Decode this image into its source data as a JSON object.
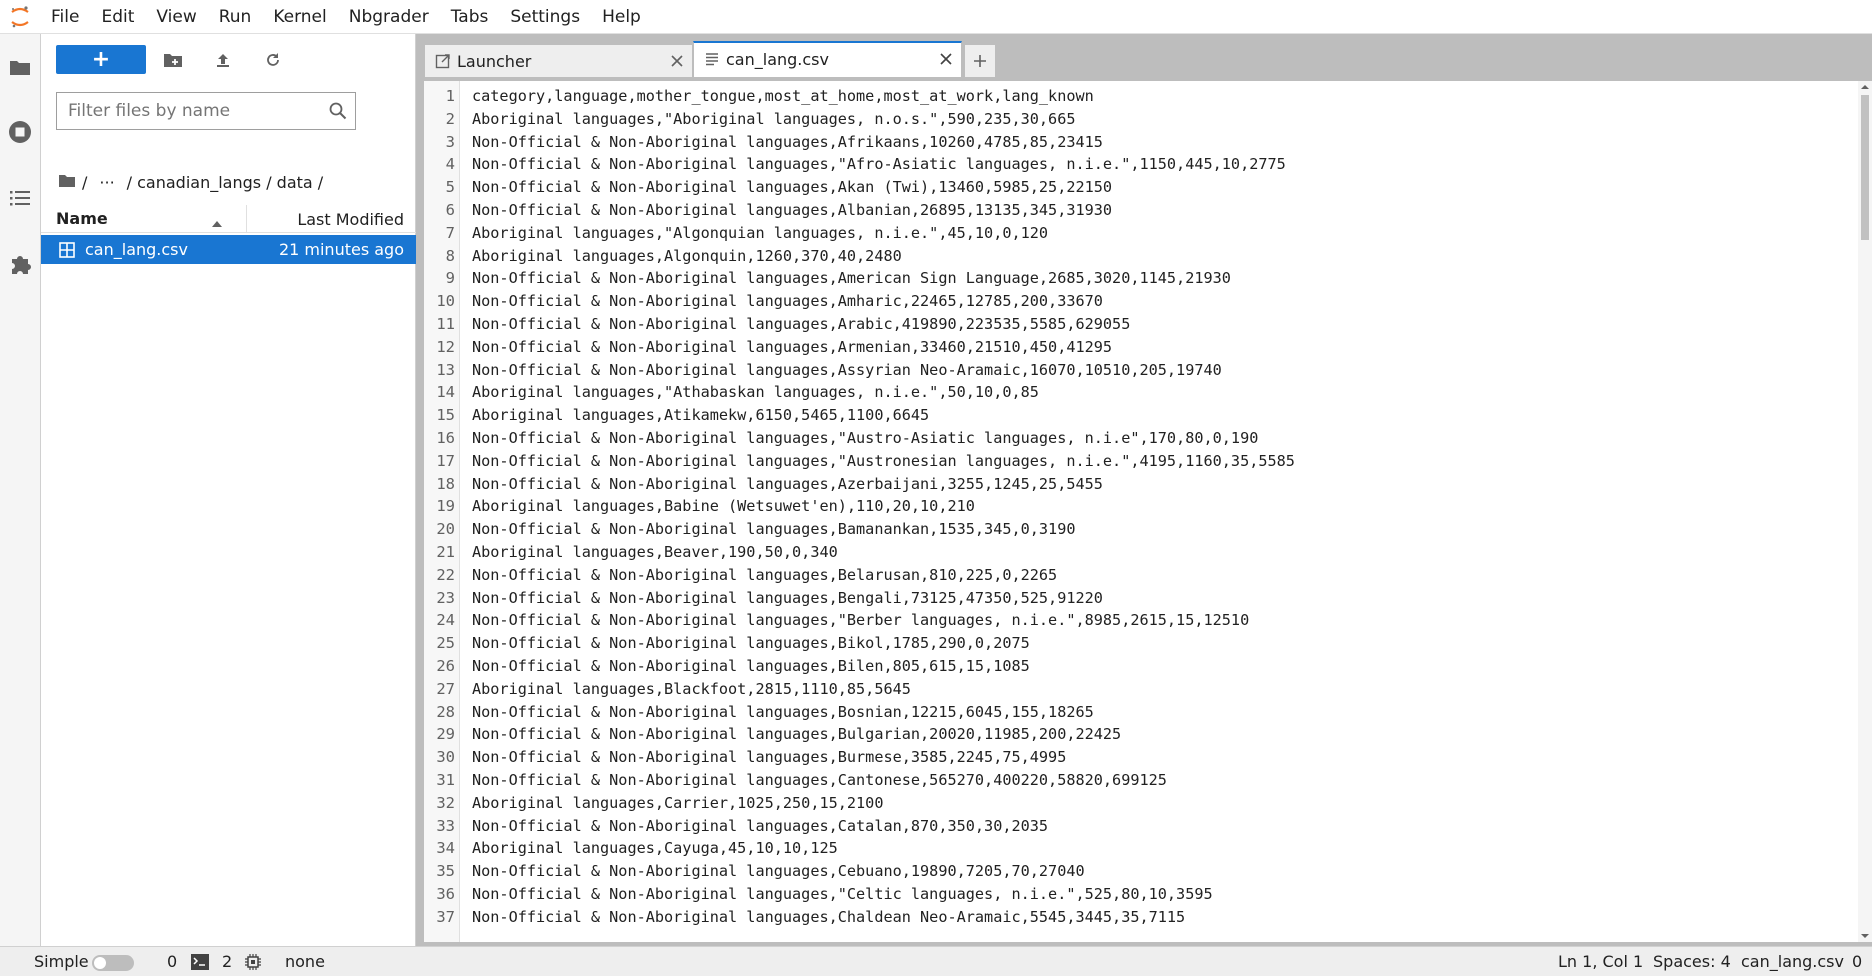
{
  "menubar": {
    "items": [
      "File",
      "Edit",
      "View",
      "Run",
      "Kernel",
      "Nbgrader",
      "Tabs",
      "Settings",
      "Help"
    ]
  },
  "filebrowser": {
    "new_button_label": "+",
    "filter_placeholder": "Filter files by name",
    "breadcrumbs": [
      "/",
      "···",
      "/ canadian_langs / data /"
    ],
    "columns": {
      "name": "Name",
      "last_modified": "Last Modified"
    },
    "files": [
      {
        "name": "can_lang.csv",
        "modified": "21 minutes ago"
      }
    ]
  },
  "tabs": [
    {
      "label": "Launcher",
      "active": false
    },
    {
      "label": "can_lang.csv",
      "active": true
    }
  ],
  "editor": {
    "lines": [
      "category,language,mother_tongue,most_at_home,most_at_work,lang_known",
      "Aboriginal languages,\"Aboriginal languages, n.o.s.\",590,235,30,665",
      "Non-Official & Non-Aboriginal languages,Afrikaans,10260,4785,85,23415",
      "Non-Official & Non-Aboriginal languages,\"Afro-Asiatic languages, n.i.e.\",1150,445,10,2775",
      "Non-Official & Non-Aboriginal languages,Akan (Twi),13460,5985,25,22150",
      "Non-Official & Non-Aboriginal languages,Albanian,26895,13135,345,31930",
      "Aboriginal languages,\"Algonquian languages, n.i.e.\",45,10,0,120",
      "Aboriginal languages,Algonquin,1260,370,40,2480",
      "Non-Official & Non-Aboriginal languages,American Sign Language,2685,3020,1145,21930",
      "Non-Official & Non-Aboriginal languages,Amharic,22465,12785,200,33670",
      "Non-Official & Non-Aboriginal languages,Arabic,419890,223535,5585,629055",
      "Non-Official & Non-Aboriginal languages,Armenian,33460,21510,450,41295",
      "Non-Official & Non-Aboriginal languages,Assyrian Neo-Aramaic,16070,10510,205,19740",
      "Aboriginal languages,\"Athabaskan languages, n.i.e.\",50,10,0,85",
      "Aboriginal languages,Atikamekw,6150,5465,1100,6645",
      "Non-Official & Non-Aboriginal languages,\"Austro-Asiatic languages, n.i.e\",170,80,0,190",
      "Non-Official & Non-Aboriginal languages,\"Austronesian languages, n.i.e.\",4195,1160,35,5585",
      "Non-Official & Non-Aboriginal languages,Azerbaijani,3255,1245,25,5455",
      "Aboriginal languages,Babine (Wetsuwet'en),110,20,10,210",
      "Non-Official & Non-Aboriginal languages,Bamanankan,1535,345,0,3190",
      "Aboriginal languages,Beaver,190,50,0,340",
      "Non-Official & Non-Aboriginal languages,Belarusan,810,225,0,2265",
      "Non-Official & Non-Aboriginal languages,Bengali,73125,47350,525,91220",
      "Non-Official & Non-Aboriginal languages,\"Berber languages, n.i.e.\",8985,2615,15,12510",
      "Non-Official & Non-Aboriginal languages,Bikol,1785,290,0,2075",
      "Non-Official & Non-Aboriginal languages,Bilen,805,615,15,1085",
      "Aboriginal languages,Blackfoot,2815,1110,85,5645",
      "Non-Official & Non-Aboriginal languages,Bosnian,12215,6045,155,18265",
      "Non-Official & Non-Aboriginal languages,Bulgarian,20020,11985,200,22425",
      "Non-Official & Non-Aboriginal languages,Burmese,3585,2245,75,4995",
      "Non-Official & Non-Aboriginal languages,Cantonese,565270,400220,58820,699125",
      "Aboriginal languages,Carrier,1025,250,15,2100",
      "Non-Official & Non-Aboriginal languages,Catalan,870,350,30,2035",
      "Aboriginal languages,Cayuga,45,10,10,125",
      "Non-Official & Non-Aboriginal languages,Cebuano,19890,7205,70,27040",
      "Non-Official & Non-Aboriginal languages,\"Celtic languages, n.i.e.\",525,80,10,3595",
      "Non-Official & Non-Aboriginal languages,Chaldean Neo-Aramaic,5545,3445,35,7115"
    ]
  },
  "statusbar": {
    "mode_label": "Simple",
    "count_a": "0",
    "terminals": "2",
    "kernel": "none",
    "cursor": "Ln 1, Col 1",
    "spaces": "Spaces: 4",
    "filename": "can_lang.csv",
    "count_b": "0"
  },
  "colors": {
    "accent": "#1976d2",
    "logo": "#f37626"
  }
}
